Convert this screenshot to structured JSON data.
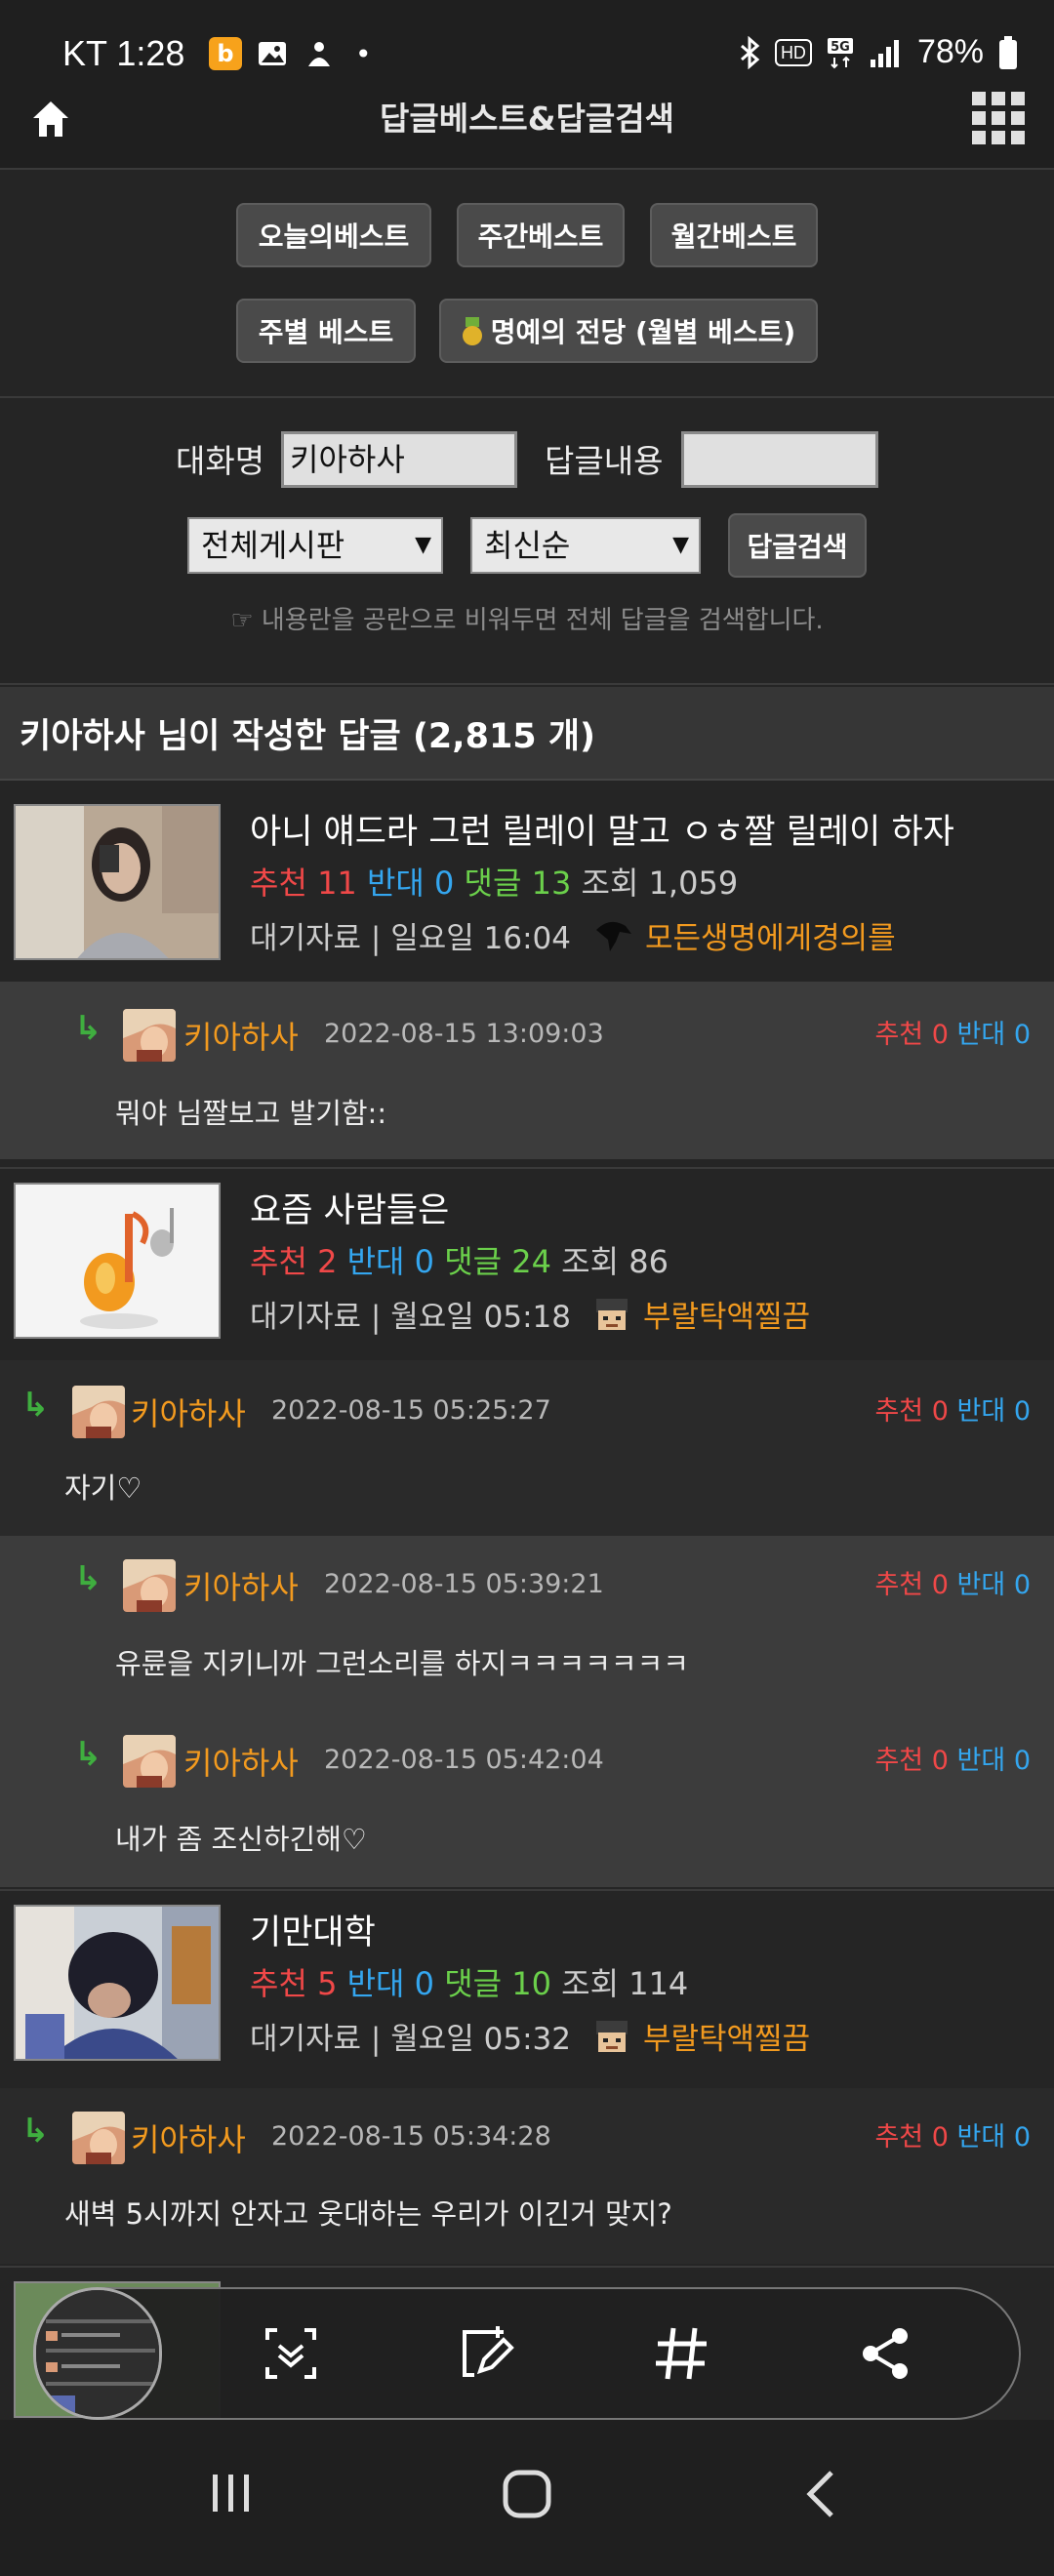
{
  "status_bar": {
    "carrier_time": "KT 1:28",
    "notification_icons": [
      "b-app-icon",
      "gallery-icon",
      "app-icon"
    ],
    "dot": "•",
    "battery": "78%",
    "signal_icons": [
      "bluetooth-icon",
      "hd-icon",
      "5g-icon",
      "signal-icon",
      "battery-icon"
    ]
  },
  "header": {
    "title": "답글베스트&답글검색",
    "left_icon": "home-icon",
    "right_icon": "grid-menu-icon"
  },
  "best_buttons": {
    "today": "오늘의베스트",
    "weekly": "주간베스트",
    "monthly": "월간베스트",
    "by_week": "주별 베스트",
    "hall_of_fame": "명예의 전당 (월별 베스트)"
  },
  "search": {
    "nickname_label": "대화명",
    "nickname_value": "키아하사",
    "content_label": "답글내용",
    "content_value": "",
    "board_select": "전체게시판",
    "sort_select": "최신순",
    "search_button": "답글검색",
    "hint": "☞ 내용란을 공란으로 비워두면 전체 답글을 검색합니다."
  },
  "section_title": "키아하사 님이 작성한 답글 (2,815 개)",
  "labels": {
    "recommend": "추천",
    "oppose": "반대",
    "comments": "댓글",
    "views": "조회"
  },
  "posts": [
    {
      "title": "아니 얘드라 그런 릴레이 말고 ㅇㅎ짤 릴레이 하자",
      "recommend": "11",
      "oppose": "0",
      "comments": "13",
      "views": "1,059",
      "meta": "대기자료 | 일요일 16:04",
      "author": "모든생명에게경의를",
      "replies": [
        {
          "indent": 2,
          "name": "키아하사",
          "date": "2022-08-15 13:09:03",
          "recommend": "0",
          "oppose": "0",
          "text": "뭐야 님짤보고 발기함::"
        }
      ]
    },
    {
      "title": "요즘 사람들은",
      "recommend": "2",
      "oppose": "0",
      "comments": "24",
      "views": "86",
      "meta": "대기자료 | 월요일 05:18",
      "author": "부랄탁액찔끔",
      "replies": [
        {
          "indent": 1,
          "name": "키아하사",
          "date": "2022-08-15 05:25:27",
          "recommend": "0",
          "oppose": "0",
          "text": "자기♡"
        },
        {
          "indent": 2,
          "name": "키아하사",
          "date": "2022-08-15 05:39:21",
          "recommend": "0",
          "oppose": "0",
          "text": "유륜을 지키니까 그런소리를 하지ㅋㅋㅋㅋㅋㅋㅋ"
        },
        {
          "indent": 2,
          "name": "키아하사",
          "date": "2022-08-15 05:42:04",
          "recommend": "0",
          "oppose": "0",
          "text": "내가 좀 조신하긴해♡"
        }
      ]
    },
    {
      "title": "기만대학",
      "recommend": "5",
      "oppose": "0",
      "comments": "10",
      "views": "114",
      "meta": "대기자료 | 월요일 05:32",
      "author": "부랄탁액찔끔",
      "replies": [
        {
          "indent": 1,
          "name": "키아하사",
          "date": "2022-08-15 05:34:28",
          "recommend": "0",
          "oppose": "0",
          "text": "새벽 5시까지 안자고 웃대하는 우리가 이긴거 맞지?"
        }
      ]
    }
  ],
  "toolbar": {
    "icons": [
      "screenshot-thumbnail",
      "scroll-capture-icon",
      "edit-icon",
      "hashtag-icon",
      "share-icon"
    ]
  },
  "nav_bar": {
    "icons": [
      "recents-icon",
      "home-nav-icon",
      "back-icon"
    ]
  }
}
